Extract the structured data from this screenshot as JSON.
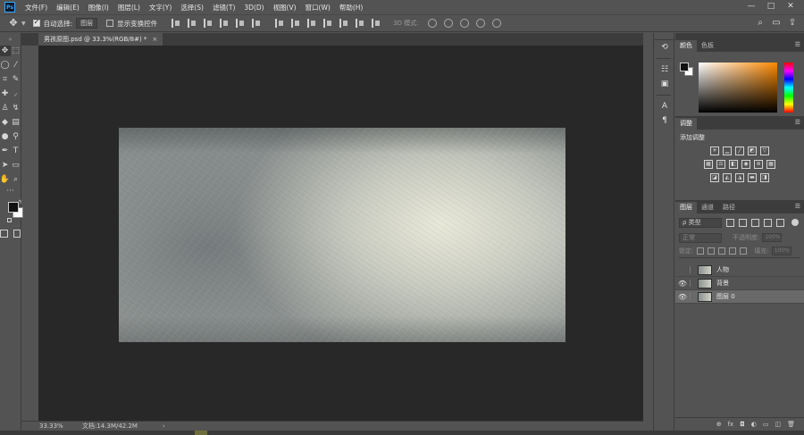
{
  "app": {
    "logo": "Ps"
  },
  "menu": [
    "文件(F)",
    "编辑(E)",
    "图像(I)",
    "图层(L)",
    "文字(Y)",
    "选择(S)",
    "滤镜(T)",
    "3D(D)",
    "视图(V)",
    "窗口(W)",
    "帮助(H)"
  ],
  "window_controls": {
    "minimize": "—",
    "maximize": "□",
    "close": "✕"
  },
  "options": {
    "auto_select_label": "自动选择:",
    "auto_select_value": "图层",
    "show_transform_label": "显示变换控件",
    "mode_3d_label": "3D 模式:"
  },
  "document_tab": {
    "title": "男孩原图.psd @ 33.3%(RGB/8#) *",
    "close": "×"
  },
  "status": {
    "zoom": "33.33%",
    "doc_info": "文档:14.3M/42.2M",
    "arrow": "›"
  },
  "color_panel": {
    "tabs": [
      "颜色",
      "色板"
    ],
    "fg_color": "#111111",
    "bg_color": "#ffffff",
    "hue_color": "#ff8a00"
  },
  "adjust_panel": {
    "tab": "调整",
    "title": "添加调整"
  },
  "layers_panel": {
    "tabs": [
      "图层",
      "通道",
      "路径"
    ],
    "filter_label": "ρ 类型",
    "blend_mode": "正常",
    "opacity_label": "不透明度:",
    "opacity_value": "100%",
    "lock_label": "锁定:",
    "fill_label": "填充:",
    "fill_value": "100%",
    "layers": [
      {
        "name": "人物",
        "visible": false,
        "selected": false
      },
      {
        "name": "背景",
        "visible": true,
        "selected": false
      },
      {
        "name": "图层 0",
        "visible": true,
        "selected": true
      }
    ],
    "footer_icons": [
      "⊕",
      "fx",
      "◘",
      "◐",
      "▭",
      "◫",
      "🗑"
    ]
  }
}
